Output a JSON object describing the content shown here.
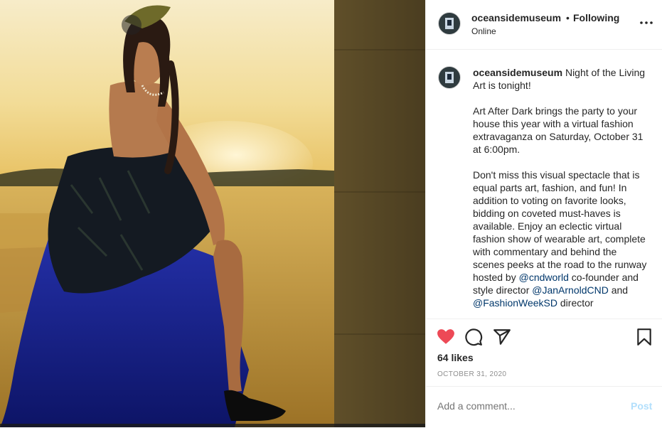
{
  "post": {
    "username": "oceansidemuseum",
    "follow_label": "Following",
    "status": "Online",
    "caption": {
      "username": "oceansidemuseum",
      "line1": "Night of the Living Art is tonight!",
      "para2": "Art After Dark brings the party to your house this year with a virtual fashion extravaganza on Saturday, October 31 at 6:00pm.",
      "para3_a": "Don't miss this visual spectacle that is equal parts art, fashion, and fun! In addition to voting on favorite looks, bidding on coveted must-haves is available. Enjoy an eclectic virtual fashion show of wearable art, complete with commentary and behind the scenes peeks at the road to the runway hosted by ",
      "mention1": "@cndworld",
      "para3_b": " co-founder and style director ",
      "mention2": "@JanArnoldCND",
      "para3_c": " and ",
      "mention3": "@FashionWeekSD",
      "para3_d": " director"
    },
    "likes": "64 likes",
    "date": "OCTOBER 31, 2020",
    "comment_placeholder": "Add a comment...",
    "post_label": "Post"
  },
  "icons": {
    "more": "more-options-icon",
    "like": "heart-icon",
    "comment": "comment-icon",
    "share": "share-icon",
    "save": "bookmark-icon"
  },
  "colors": {
    "like": "#ed4956",
    "mention": "#00376b",
    "post_disabled": "#b2dffc"
  }
}
